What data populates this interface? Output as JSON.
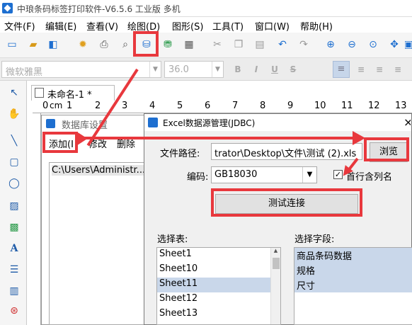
{
  "titlebar": {
    "title": "中琅条码标签打印软件-V6.5.6 工业版 多机"
  },
  "menu": [
    "文件(F)",
    "编辑(E)",
    "查看(V)",
    "绘图(D)",
    "图形(S)",
    "工具(T)",
    "窗口(W)",
    "帮助(H)"
  ],
  "fontbar": {
    "font_name": "微软雅黑",
    "font_size": "36.0",
    "bold": "B",
    "italic": "I",
    "underline": "U",
    "strike": "S"
  },
  "doc_tab": {
    "label": "未命名-1 *"
  },
  "ruler": {
    "marks": [
      "0",
      "cm",
      "1",
      "2",
      "3",
      "4",
      "5",
      "6",
      "7",
      "8",
      "9",
      "10",
      "11",
      "12",
      "13"
    ]
  },
  "datasource_panel": {
    "title": "数据库设置",
    "add_label": "添加(I",
    "modify_label": "修改",
    "delete_label": "删除",
    "entry": "C:\\Users\\Administr..."
  },
  "dialog": {
    "title": "Excel数据源管理(JDBC)",
    "close": "×",
    "path_label": "文件路径:",
    "path_value": "trator\\Desktop\\文件\\测试 (2).xls",
    "browse_label": "浏览",
    "encoding_label": "编码:",
    "encoding_value": "GB18030",
    "header_checkbox_label": "首行含列名",
    "test_label": "测试连接",
    "tables_label": "选择表:",
    "tables": [
      "Sheet1",
      "Sheet10",
      "Sheet11",
      "Sheet12",
      "Sheet13"
    ],
    "selected_table": "Sheet11",
    "fields_label": "选择字段:",
    "fields": [
      "商品条码数据",
      "规格",
      "尺寸"
    ]
  },
  "colors": {
    "annotation_red": "#e8383d",
    "selection": "#c9d7ea",
    "accent_blue": "#1e6fd0"
  }
}
